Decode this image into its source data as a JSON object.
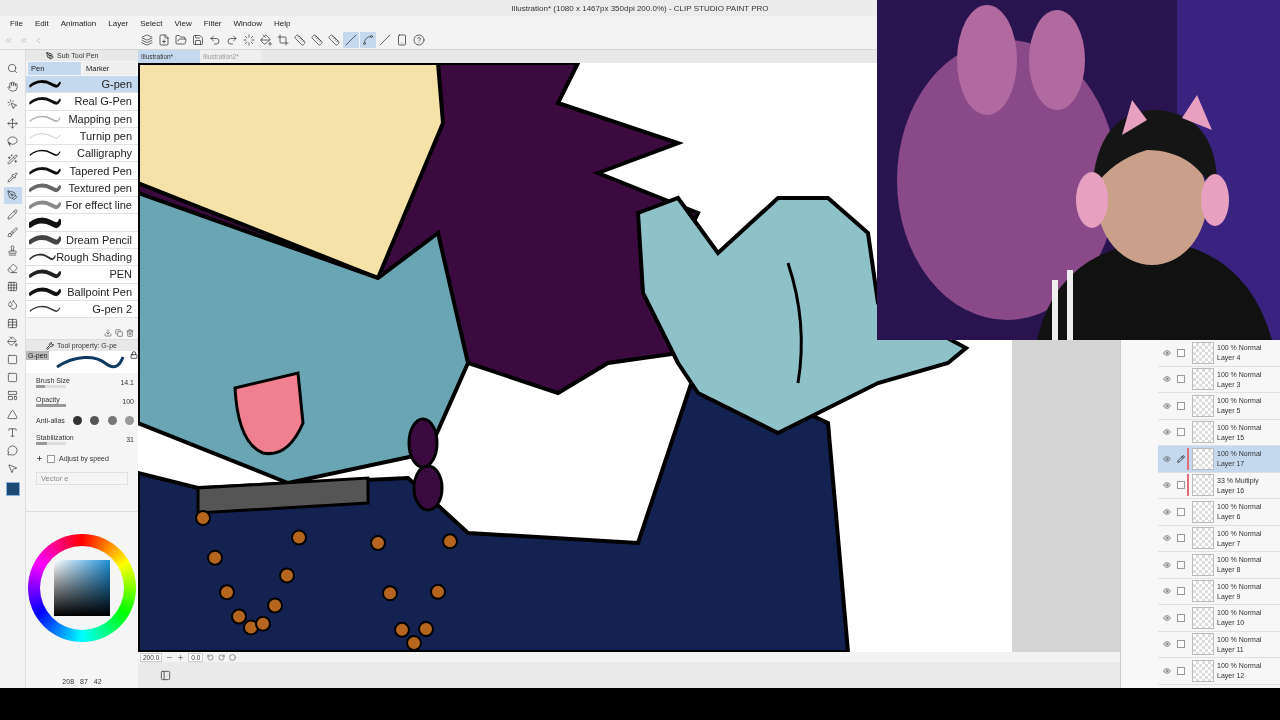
{
  "window": {
    "title": "Illustration* (1080 x 1467px 350dpi 200.0%) - CLIP STUDIO PAINT PRO"
  },
  "menu": [
    "File",
    "Edit",
    "Animation",
    "Layer",
    "Select",
    "View",
    "Filter",
    "Window",
    "Help"
  ],
  "toolbar": [
    {
      "kind": "logo",
      "selected": false
    },
    {
      "kind": "new",
      "selected": false
    },
    {
      "kind": "open",
      "selected": false
    },
    {
      "kind": "save",
      "selected": false
    },
    {
      "kind": "undo",
      "selected": false
    },
    {
      "kind": "redo",
      "selected": false
    },
    {
      "kind": "selectall",
      "selected": false
    },
    {
      "kind": "fill",
      "selected": false
    },
    {
      "kind": "crop",
      "selected": false
    },
    {
      "kind": "ruler",
      "selected": false
    },
    {
      "kind": "ruler",
      "selected": false
    },
    {
      "kind": "ruler",
      "selected": false
    },
    {
      "kind": "line",
      "selected": true
    },
    {
      "kind": "curve",
      "selected": true
    },
    {
      "kind": "line",
      "selected": false
    },
    {
      "kind": "device",
      "selected": false
    },
    {
      "kind": "help",
      "selected": false
    }
  ],
  "document_tabs": [
    {
      "label": "Illustration*",
      "selected": true
    },
    {
      "label": "Illustration2*",
      "selected": false
    }
  ],
  "tools": [
    {
      "kind": "search",
      "selected": false
    },
    {
      "kind": "hand",
      "selected": false
    },
    {
      "kind": "pointer",
      "selected": false
    },
    {
      "kind": "move",
      "selected": false
    },
    {
      "kind": "lasso",
      "selected": false
    },
    {
      "kind": "wand",
      "selected": false
    },
    {
      "kind": "dropper",
      "selected": false
    },
    {
      "kind": "pen",
      "selected": true
    },
    {
      "kind": "pencil",
      "selected": false
    },
    {
      "kind": "brush",
      "selected": false
    },
    {
      "kind": "stamp",
      "selected": false
    },
    {
      "kind": "eraser",
      "selected": false
    },
    {
      "kind": "grid",
      "selected": false
    },
    {
      "kind": "blend",
      "selected": false
    },
    {
      "kind": "table",
      "selected": false
    },
    {
      "kind": "fill",
      "selected": false
    },
    {
      "kind": "gradient",
      "selected": false
    },
    {
      "kind": "square",
      "selected": false
    },
    {
      "kind": "layout",
      "selected": false
    },
    {
      "kind": "triangle",
      "selected": false
    },
    {
      "kind": "text",
      "selected": false
    },
    {
      "kind": "balloon",
      "selected": false
    },
    {
      "kind": "pointer2",
      "selected": false
    }
  ],
  "sub_tool": {
    "title": "Sub Tool Pen",
    "groups": [
      {
        "label": "Pen",
        "selected": true
      },
      {
        "label": "Marker",
        "selected": false
      }
    ],
    "brushes": [
      {
        "name": "G-pen",
        "selected": true
      },
      {
        "name": "Real G-Pen",
        "selected": false
      },
      {
        "name": "Mapping pen",
        "selected": false
      },
      {
        "name": "Turnip pen",
        "selected": false
      },
      {
        "name": "Calligraphy",
        "selected": false
      },
      {
        "name": "Tapered Pen",
        "selected": false
      },
      {
        "name": "Textured pen",
        "selected": false
      },
      {
        "name": "For effect line",
        "selected": false
      },
      {
        "selected": false
      },
      {
        "name": "Dream Pencil",
        "selected": false
      },
      {
        "name": "Rough Shading",
        "selected": false
      },
      {
        "name": "PEN",
        "selected": false
      },
      {
        "name": "Ballpoint Pen",
        "selected": false
      },
      {
        "name": "G-pen 2",
        "selected": false
      }
    ]
  },
  "tool_property": {
    "title": "Tool property: G-pe",
    "preview": "G-pen",
    "rows": [
      {
        "kind": "slider",
        "label": "Brush Size",
        "value": "14.1",
        "level": 0.3
      },
      {
        "kind": "slider",
        "label": "Opacity",
        "value": "100",
        "level": 1
      },
      {
        "kind": "tips",
        "label": "Anti-alias"
      },
      {
        "kind": "slider",
        "label": "Stabilization",
        "value": "31",
        "level": 0.35
      },
      {
        "kind": "check",
        "label": "Adjust by speed",
        "checked": false
      }
    ],
    "vector": "Vector e"
  },
  "color": {
    "readout": [
      "208",
      "87",
      "42"
    ]
  },
  "navigator": {
    "zoom": "200.0",
    "angle": "0.0"
  },
  "layers": [
    {
      "mode": "100 % Normal",
      "name": "Layer 4",
      "selected": false,
      "clipped": false
    },
    {
      "mode": "100 % Normal",
      "name": "Layer 3",
      "selected": false,
      "clipped": false
    },
    {
      "mode": "100 % Normal",
      "name": "Layer 5",
      "selected": false,
      "clipped": false
    },
    {
      "mode": "100 % Normal",
      "name": "Layer 15",
      "selected": false,
      "clipped": false
    },
    {
      "mode": "100 % Normal",
      "name": "Layer 17",
      "selected": true,
      "clipped": true
    },
    {
      "mode": "33 % Multiply",
      "name": "Layer 16",
      "selected": false,
      "clipped": true
    },
    {
      "mode": "100 % Normal",
      "name": "Layer 6",
      "selected": false,
      "clipped": false
    },
    {
      "mode": "100 % Normal",
      "name": "Layer 7",
      "selected": false,
      "clipped": false
    },
    {
      "mode": "100 % Normal",
      "name": "Layer 8",
      "selected": false,
      "clipped": false
    },
    {
      "mode": "100 % Normal",
      "name": "Layer 9",
      "selected": false,
      "clipped": false
    },
    {
      "mode": "100 % Normal",
      "name": "Layer 10",
      "selected": false,
      "clipped": false
    },
    {
      "mode": "100 % Normal",
      "name": "Layer 11",
      "selected": false,
      "clipped": false
    },
    {
      "mode": "100 % Normal",
      "name": "Layer 12",
      "selected": false,
      "clipped": false
    }
  ]
}
